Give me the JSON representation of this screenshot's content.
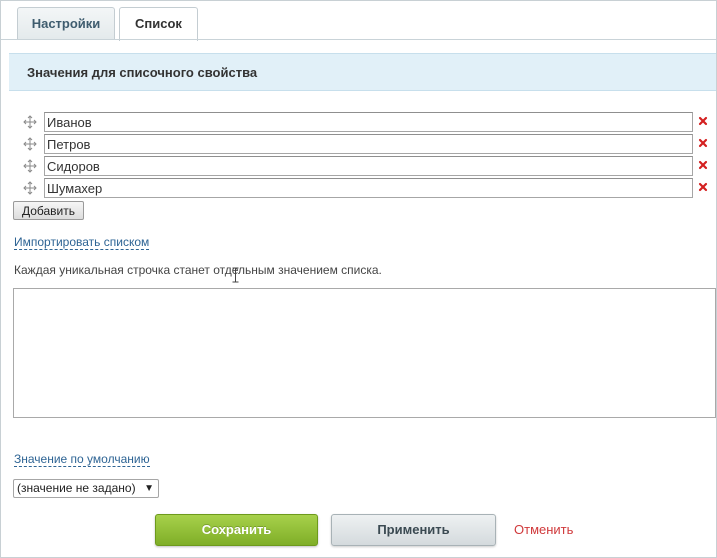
{
  "tabs": [
    {
      "label": "Настройки",
      "active": false
    },
    {
      "label": "Список",
      "active": true
    }
  ],
  "section": {
    "title": "Значения для списочного свойства"
  },
  "values": [
    {
      "value": "Иванов"
    },
    {
      "value": "Петров"
    },
    {
      "value": "Сидоров"
    },
    {
      "value": "Шумахер"
    }
  ],
  "add_button_label": "Добавить",
  "import": {
    "link_label": "Импортировать списком",
    "hint": "Каждая уникальная строчка станет отдельным значением списка.",
    "textarea_value": ""
  },
  "default_value": {
    "link_label": "Значение по умолчанию",
    "selected": "(значение не задано)"
  },
  "footer": {
    "save_label": "Сохранить",
    "apply_label": "Применить",
    "cancel_label": "Отменить"
  },
  "colors": {
    "accent_green": "#8bbd2f",
    "header_bg": "#e1f0f8",
    "link_blue": "#2e6494",
    "cancel_red": "#d0393b",
    "delete_red": "#d42020"
  },
  "icons": {
    "drag": "drag-handle-icon",
    "delete": "delete-icon",
    "dropdown": "chevron-down-icon"
  }
}
